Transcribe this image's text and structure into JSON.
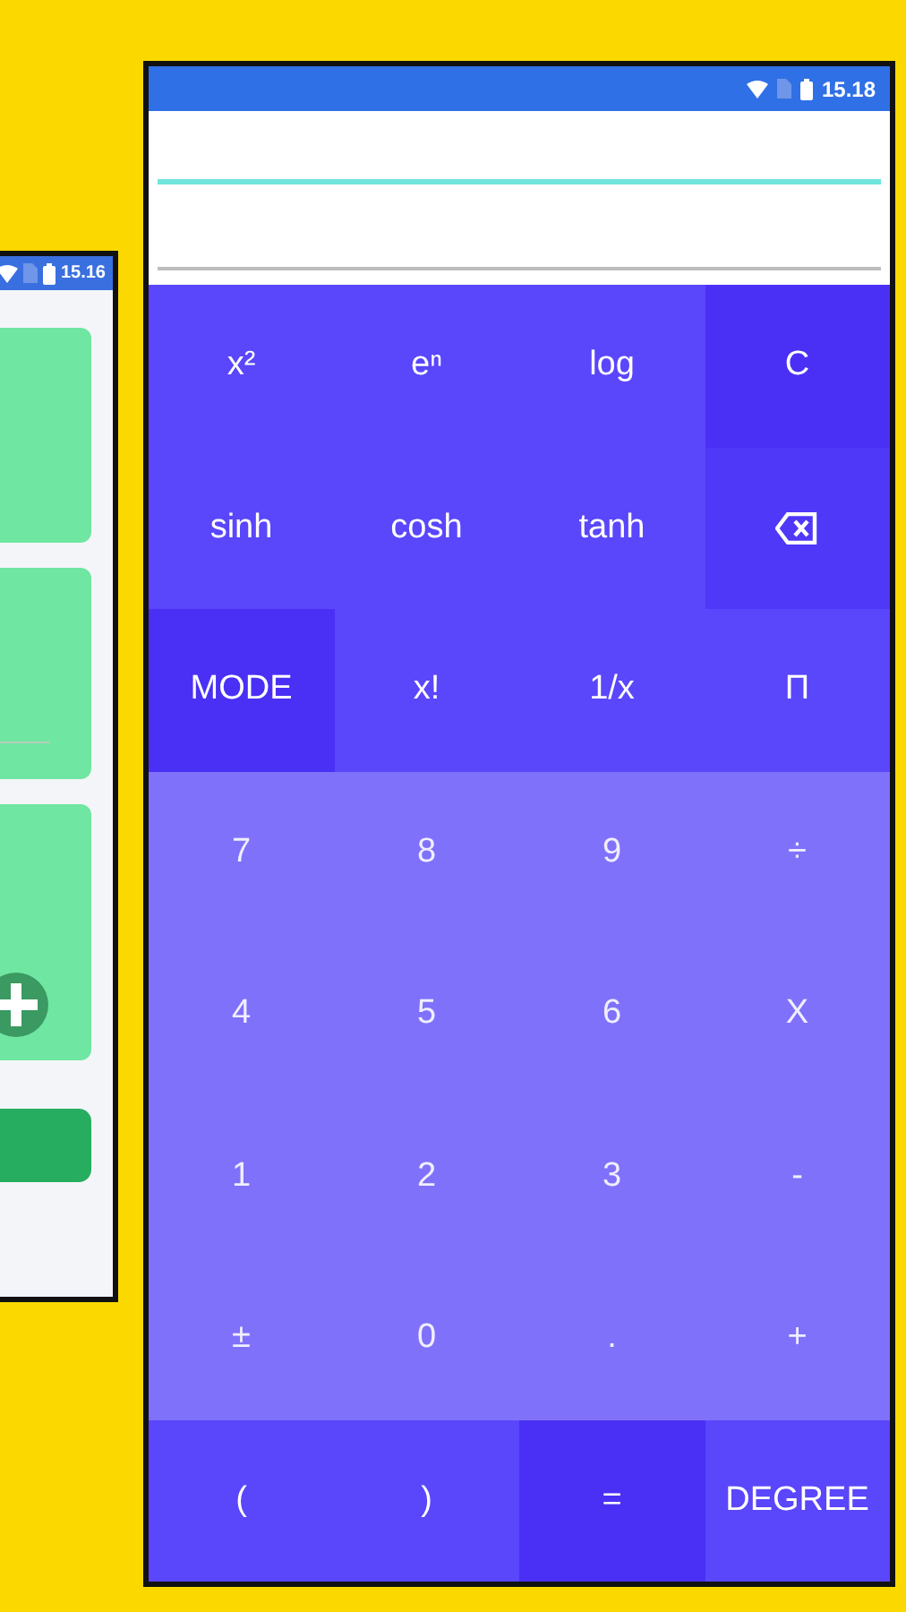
{
  "back_phone": {
    "status_bar": {
      "time": "15.16"
    }
  },
  "phone": {
    "status_bar": {
      "time": "15.18"
    },
    "keypad": [
      {
        "label": "x²",
        "kind": "function"
      },
      {
        "label": "eⁿ",
        "kind": "function"
      },
      {
        "label": "log",
        "kind": "function"
      },
      {
        "label": "C",
        "kind": "accent"
      },
      {
        "label": "sinh",
        "kind": "function"
      },
      {
        "label": "cosh",
        "kind": "function"
      },
      {
        "label": "tanh",
        "kind": "function"
      },
      {
        "kind": "backspace"
      },
      {
        "label": "MODE",
        "kind": "accent"
      },
      {
        "label": "x!",
        "kind": "function"
      },
      {
        "label": "1/x",
        "kind": "function"
      },
      {
        "label": "Π",
        "kind": "function"
      },
      {
        "label": "7",
        "kind": "number"
      },
      {
        "label": "8",
        "kind": "number"
      },
      {
        "label": "9",
        "kind": "number"
      },
      {
        "label": "÷",
        "kind": "number"
      },
      {
        "label": "4",
        "kind": "number"
      },
      {
        "label": "5",
        "kind": "number"
      },
      {
        "label": "6",
        "kind": "number"
      },
      {
        "label": "X",
        "kind": "number"
      },
      {
        "label": "1",
        "kind": "number"
      },
      {
        "label": "2",
        "kind": "number"
      },
      {
        "label": "3",
        "kind": "number"
      },
      {
        "label": "-",
        "kind": "number"
      },
      {
        "label": "±",
        "kind": "number"
      },
      {
        "label": "0",
        "kind": "number"
      },
      {
        "label": ".",
        "kind": "number"
      },
      {
        "label": "+",
        "kind": "number"
      },
      {
        "label": "(",
        "kind": "function"
      },
      {
        "label": ")",
        "kind": "function"
      },
      {
        "label": "=",
        "kind": "accent"
      },
      {
        "label": "DEGREE",
        "kind": "function"
      }
    ]
  }
}
